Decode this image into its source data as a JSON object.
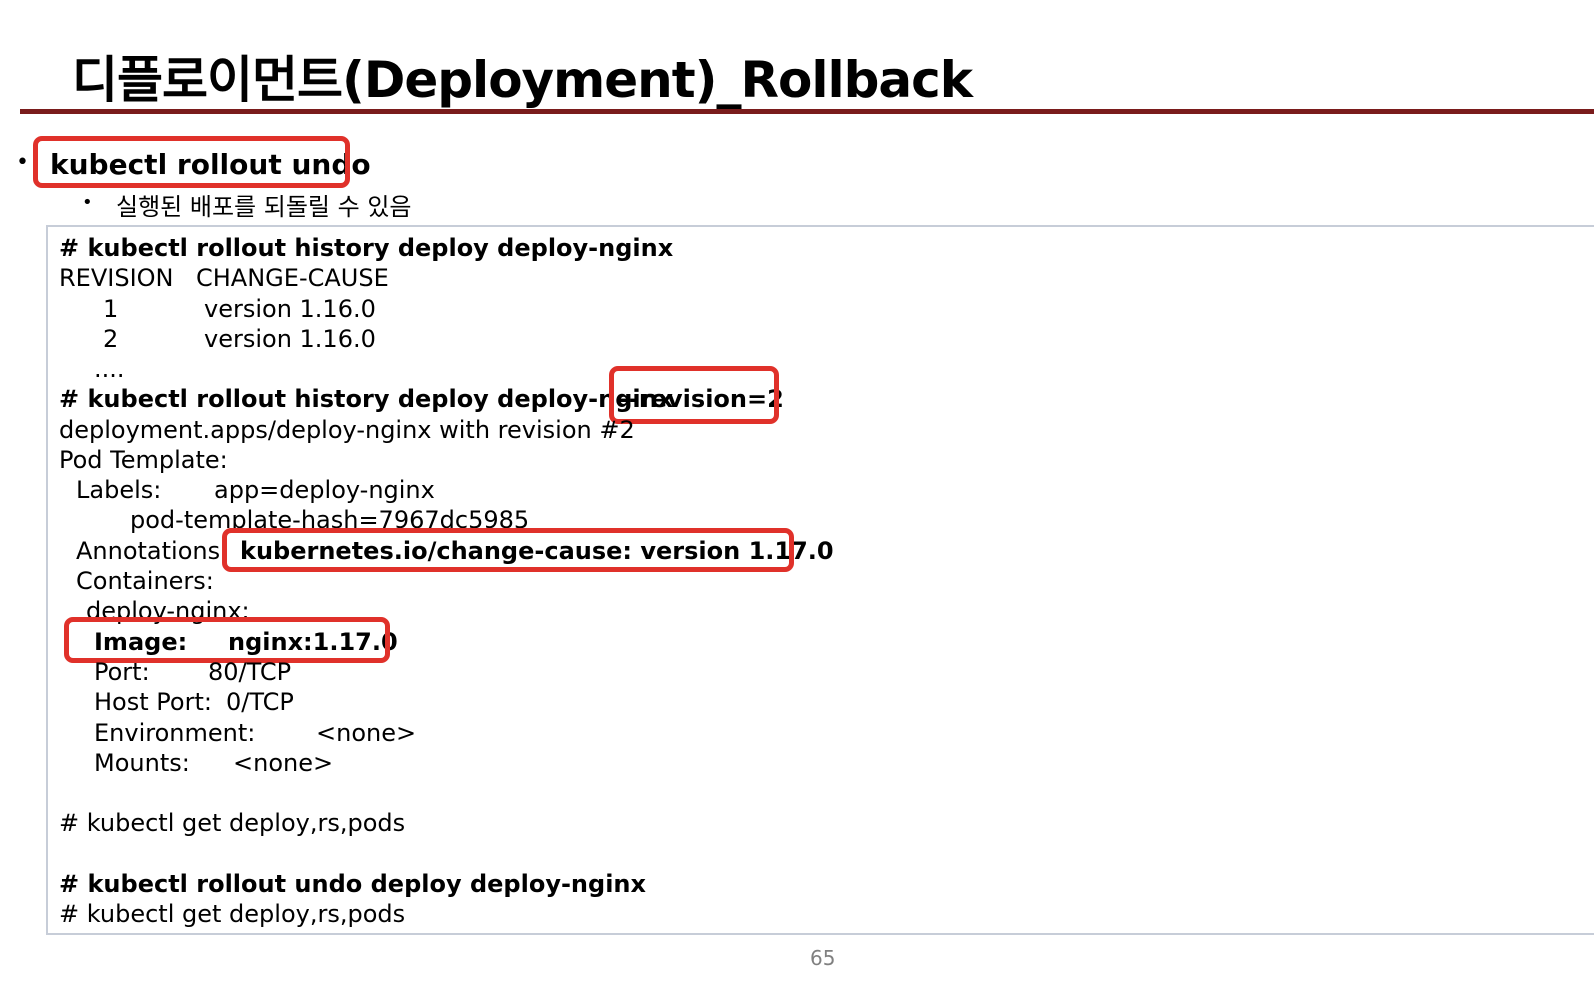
{
  "slide": {
    "title": "디플로이먼트(Deployment)_Rollback",
    "bullet_symbol": "•",
    "heading": "kubectl rollout undo",
    "sub_bullet_symbol": "•",
    "subtext": "실행된 배포를 되돌릴 수 있음",
    "page_number": "65"
  },
  "code": {
    "cmd_history": "# kubectl rollout history deploy deploy-nginx",
    "col_revision": "REVISION",
    "col_change_cause": "CHANGE-CAUSE",
    "rows": [
      {
        "revision": "1",
        "cause": "version 1.16.0"
      },
      {
        "revision": "2",
        "cause": "version 1.16.0"
      }
    ],
    "ellipsis": "....",
    "cmd_history_rev": "# kubectl rollout history deploy deploy-nginx",
    "revision_flag": "--revision=2",
    "deploy_with_rev": "deployment.apps/deploy-nginx with revision #2",
    "pod_template": "Pod Template:",
    "labels_key": "Labels:",
    "labels_val": "app=deploy-nginx",
    "pod_template_hash": "pod-template-hash=7967dc5985",
    "annotations_key": "Annotations:",
    "annotations_val": "kubernetes.io/change-cause: version 1.17.0",
    "containers": "Containers:",
    "container_name": "deploy-nginx:",
    "image_key": "Image:",
    "image_val": "nginx:1.17.0",
    "port_key": "Port:",
    "port_val": "80/TCP",
    "host_port_key": "Host Port:",
    "host_port_val": "0/TCP",
    "env_key": "Environment:",
    "env_val": "<none>",
    "mounts_key": "Mounts:",
    "mounts_val": "<none>",
    "cmd_get_1": "# kubectl get deploy,rs,pods",
    "cmd_undo": "# kubectl rollout undo deploy deploy-nginx",
    "cmd_get_2": "# kubectl get deploy,rs,pods"
  },
  "colors": {
    "title_rule": "#7a1c1c",
    "highlight": "#e0312a",
    "box_border": "#c7cdd8"
  }
}
